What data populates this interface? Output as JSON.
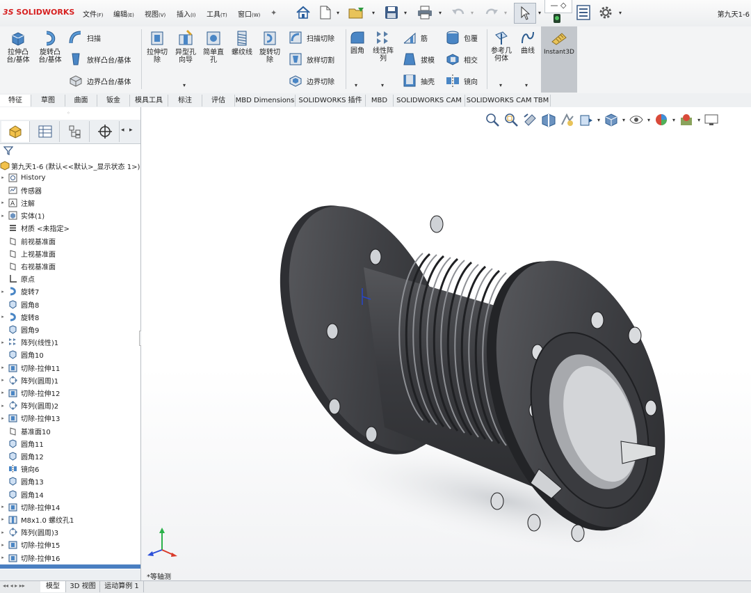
{
  "app": {
    "logo_prefix": "3S",
    "logo_text": "SOLIDWORKS",
    "document_title": "第九天1-6"
  },
  "menu": [
    {
      "label": "文件",
      "key": "(F)"
    },
    {
      "label": "编辑",
      "key": "(E)"
    },
    {
      "label": "视图",
      "key": "(V)"
    },
    {
      "label": "插入",
      "key": "(I)"
    },
    {
      "label": "工具",
      "key": "(T)"
    },
    {
      "label": "窗口",
      "key": "(W)"
    }
  ],
  "quick_access": [
    "home-icon",
    "new-document-icon",
    "open-icon",
    "save-icon",
    "print-icon",
    "undo-icon",
    "redo-icon",
    "select-icon",
    "rebuild-icon",
    "file-properties-icon",
    "options-icon"
  ],
  "ribbon": {
    "extrude_boss": "拉伸凸\n台/基体",
    "revolve_boss": "旋转凸\n台/基体",
    "sweep": "扫描",
    "loft_boss": "放样凸台/基体",
    "boundary_boss": "边界凸台/基体",
    "extrude_cut": "拉伸切\n除",
    "hole_wizard": "异型孔\n向导",
    "simple_hole": "简单直\n孔",
    "thread": "螺纹线",
    "revolve_cut": "旋转切\n除",
    "sweep_cut": "扫描切除",
    "loft_cut": "放样切割",
    "boundary_cut": "边界切除",
    "fillet": "圆角",
    "linear_pattern": "线性阵\n列",
    "rib": "筋",
    "draft": "拔模",
    "shell": "抽壳",
    "wrap": "包覆",
    "intersect": "相交",
    "mirror": "镜向",
    "ref_geometry": "参考几\n何体",
    "curves": "曲线",
    "instant3d": "Instant3D"
  },
  "command_tabs": [
    "特征",
    "草图",
    "曲面",
    "钣金",
    "模具工具",
    "标注",
    "评估",
    "MBD Dimensions",
    "SOLIDWORKS 插件",
    "MBD",
    "SOLIDWORKS CAM",
    "SOLIDWORKS CAM TBM"
  ],
  "active_command_tab": "特征",
  "feature_tree": {
    "root": "第九天1-6  (默认<<默认>_显示状态 1>)",
    "items": [
      {
        "label": "History",
        "icon": "history-icon",
        "expand": true
      },
      {
        "label": "传感器",
        "icon": "sensor-icon",
        "expand": false
      },
      {
        "label": "注解",
        "icon": "annotation-icon",
        "expand": true
      },
      {
        "label": "实体(1)",
        "icon": "solid-bodies-icon",
        "expand": true
      },
      {
        "label": "材质 <未指定>",
        "icon": "material-icon",
        "expand": false
      },
      {
        "label": "前视基准面",
        "icon": "plane-icon",
        "expand": false
      },
      {
        "label": "上视基准面",
        "icon": "plane-icon",
        "expand": false
      },
      {
        "label": "右视基准面",
        "icon": "plane-icon",
        "expand": false
      },
      {
        "label": "原点",
        "icon": "origin-icon",
        "expand": false
      },
      {
        "label": "旋转7",
        "icon": "revolve-icon",
        "expand": true
      },
      {
        "label": "圆角8",
        "icon": "fillet-icon",
        "expand": false
      },
      {
        "label": "旋转8",
        "icon": "revolve-icon",
        "expand": true
      },
      {
        "label": "圆角9",
        "icon": "fillet-icon",
        "expand": false
      },
      {
        "label": "阵列(线性)1",
        "icon": "linear-pattern-icon",
        "expand": true
      },
      {
        "label": "圆角10",
        "icon": "fillet-icon",
        "expand": false
      },
      {
        "label": "切除-拉伸11",
        "icon": "cut-extrude-icon",
        "expand": true
      },
      {
        "label": "阵列(圆周)1",
        "icon": "circular-pattern-icon",
        "expand": true
      },
      {
        "label": "切除-拉伸12",
        "icon": "cut-extrude-icon",
        "expand": true
      },
      {
        "label": "阵列(圆周)2",
        "icon": "circular-pattern-icon",
        "expand": true
      },
      {
        "label": "切除-拉伸13",
        "icon": "cut-extrude-icon",
        "expand": true
      },
      {
        "label": "基准面10",
        "icon": "plane-icon",
        "expand": false
      },
      {
        "label": "圆角11",
        "icon": "fillet-icon",
        "expand": false
      },
      {
        "label": "圆角12",
        "icon": "fillet-icon",
        "expand": false
      },
      {
        "label": "镜向6",
        "icon": "mirror-icon",
        "expand": false
      },
      {
        "label": "圆角13",
        "icon": "fillet-icon",
        "expand": false
      },
      {
        "label": "圆角14",
        "icon": "fillet-icon",
        "expand": false
      },
      {
        "label": "切除-拉伸14",
        "icon": "cut-extrude-icon",
        "expand": true
      },
      {
        "label": "M8x1.0 螺纹孔1",
        "icon": "hole-icon",
        "expand": true
      },
      {
        "label": "阵列(圆周)3",
        "icon": "circular-pattern-icon",
        "expand": true
      },
      {
        "label": "切除-拉伸15",
        "icon": "cut-extrude-icon",
        "expand": true
      },
      {
        "label": "切除-拉伸16",
        "icon": "cut-extrude-icon",
        "expand": true
      }
    ]
  },
  "viewport": {
    "view_label": "*等轴测"
  },
  "heads_up_toolbar": [
    "zoom-to-fit-icon",
    "zoom-area-icon",
    "previous-view-icon",
    "section-view-icon",
    "dynamic-annotation-icon",
    "view-orientation-icon",
    "display-style-icon",
    "hide-show-icon",
    "edit-appearance-icon",
    "apply-scene-icon",
    "view-settings-icon"
  ],
  "bottom_tabs": [
    "模型",
    "3D 视图",
    "运动算例 1"
  ],
  "active_bottom_tab": "模型"
}
